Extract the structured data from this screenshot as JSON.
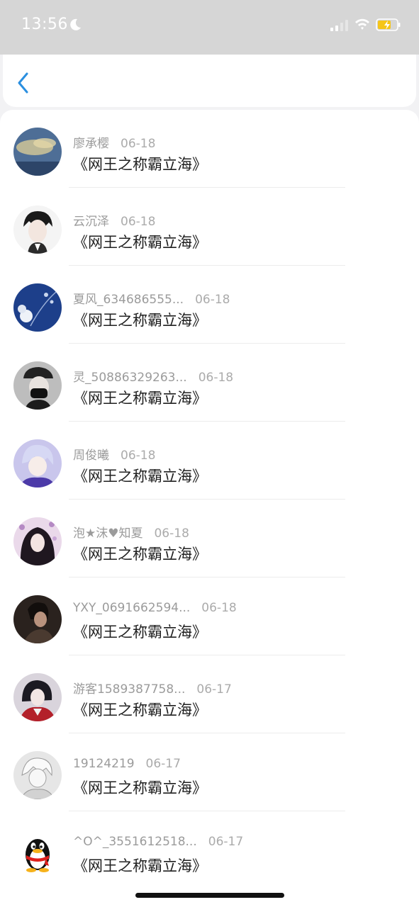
{
  "status_bar": {
    "time": "13:56",
    "icons": [
      "moon-icon",
      "signal-icon",
      "wifi-icon",
      "battery-charging-icon"
    ]
  },
  "nav": {
    "back_icon": "chevron-left-icon",
    "accent_color": "#2a8fe0"
  },
  "items": [
    {
      "author": "廖承樱",
      "date": "06-18",
      "title": "《网王之称霸立海》",
      "avatar": "sky-landscape-avatar"
    },
    {
      "author": "云沉泽",
      "date": "06-18",
      "title": "《网王之称霸立海》",
      "avatar": "anime-boy-avatar"
    },
    {
      "author": "夏风_634686555...",
      "date": "06-18",
      "title": "《网王之称霸立海》",
      "avatar": "blue-flowers-avatar"
    },
    {
      "author": "灵_50886329263...",
      "date": "06-18",
      "title": "《网王之称霸立海》",
      "avatar": "masked-person-avatar"
    },
    {
      "author": "周俊曦",
      "date": "06-18",
      "title": "《网王之称霸立海》",
      "avatar": "anime-purple-hair-avatar"
    },
    {
      "author": "泡★沫♥知夏",
      "date": "06-18",
      "title": "《网王之称霸立海》",
      "avatar": "anime-girl-flowers-avatar"
    },
    {
      "author": "YXY_0691662594...",
      "date": "06-18",
      "title": "《网王之称霸立海》",
      "avatar": "dark-portrait-avatar"
    },
    {
      "author": "游客1589387758...",
      "date": "06-17",
      "title": "《网王之称霸立海》",
      "avatar": "anime-red-kimono-avatar"
    },
    {
      "author": "19124219",
      "date": "06-17",
      "title": "《网王之称霸立海》",
      "avatar": "sketch-anime-avatar"
    },
    {
      "author": "^O^_3551612518...",
      "date": "06-17",
      "title": "《网王之称霸立海》",
      "avatar": "qq-penguin-avatar"
    }
  ]
}
